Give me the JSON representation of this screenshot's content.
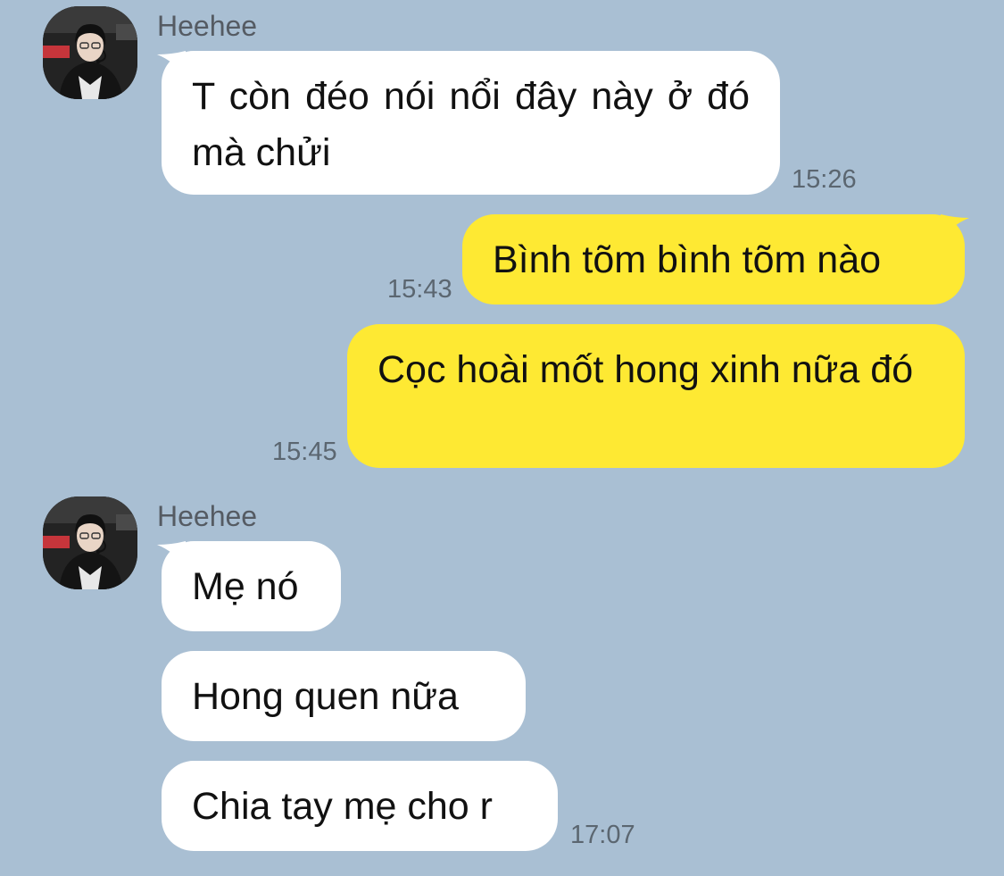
{
  "colors": {
    "background": "#a9bfd3",
    "incoming_bubble": "#ffffff",
    "outgoing_bubble": "#fee933",
    "timestamp": "#5b6670",
    "sender_name": "#555b63"
  },
  "groups": [
    {
      "sender": "Heehee",
      "avatar_icon": "user-avatar-photo",
      "messages": [
        {
          "text": "T còn đéo nói nổi đây này ở đó mà chửi",
          "time": "15:26"
        }
      ]
    },
    {
      "sender": "me",
      "messages": [
        {
          "text": "Bình tõm bình tõm nào",
          "time": "15:43"
        },
        {
          "text": "Cọc hoài mốt hong xinh nữa đó",
          "time": "15:45"
        }
      ]
    },
    {
      "sender": "Heehee",
      "avatar_icon": "user-avatar-photo",
      "messages": [
        {
          "text": "Mẹ nó"
        },
        {
          "text": "Hong quen nữa"
        },
        {
          "text": "Chia tay mẹ cho r",
          "time": "17:07"
        }
      ]
    }
  ]
}
